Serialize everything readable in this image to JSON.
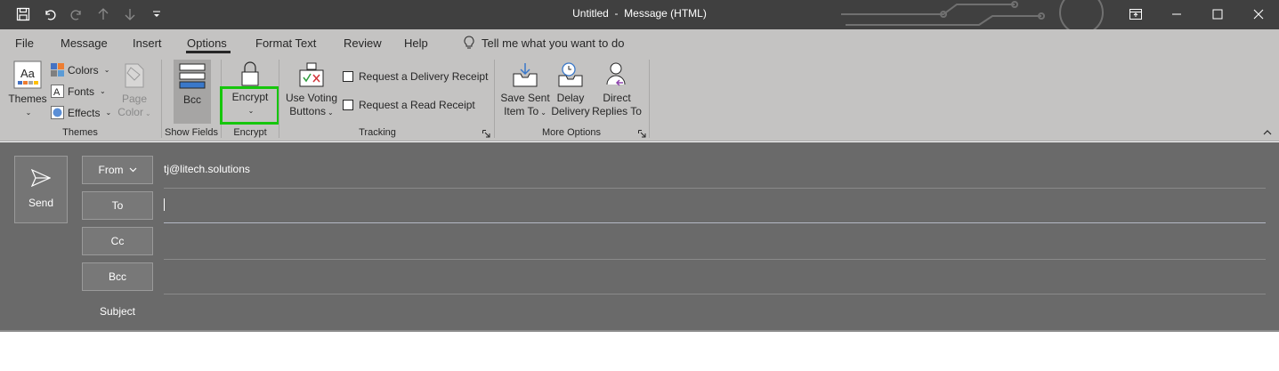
{
  "window": {
    "title": "Untitled  -  Message (HTML)",
    "controls": [
      "ribbon-display-options-icon",
      "minimize-icon",
      "maximize-icon",
      "close-icon"
    ]
  },
  "quick_access": [
    "save-icon",
    "undo-icon",
    "redo-icon",
    "previous-item-icon",
    "next-item-icon",
    "customize-qat-icon"
  ],
  "tabs": [
    {
      "label": "File"
    },
    {
      "label": "Message"
    },
    {
      "label": "Insert"
    },
    {
      "label": "Options"
    },
    {
      "label": "Format Text"
    },
    {
      "label": "Review"
    },
    {
      "label": "Help"
    }
  ],
  "active_tab": "Options",
  "tell_me": {
    "label": "Tell me what you want to do",
    "icon": "lightbulb-icon"
  },
  "ribbon": {
    "themes_group": {
      "label": "Themes",
      "themes_button": "Themes",
      "colors": "Colors",
      "fonts": "Fonts",
      "effects": "Effects",
      "page_color_line1": "Page",
      "page_color_line2": "Color"
    },
    "show_fields_group": {
      "label": "Show Fields",
      "bcc": "Bcc"
    },
    "encrypt_group": {
      "label": "Encrypt",
      "encrypt": "Encrypt"
    },
    "tracking_group": {
      "label": "Tracking",
      "voting_line1": "Use Voting",
      "voting_line2": "Buttons",
      "delivery_receipt": "Request a Delivery Receipt",
      "read_receipt": "Request a Read Receipt"
    },
    "more_options_group": {
      "label": "More Options",
      "save_sent_line1": "Save Sent",
      "save_sent_line2": "Item To",
      "delay_line1": "Delay",
      "delay_line2": "Delivery",
      "direct_line1": "Direct",
      "direct_line2": "Replies To"
    }
  },
  "compose": {
    "send": "Send",
    "from_label": "From",
    "from_value": "tj@litech.solutions",
    "to_label": "To",
    "cc_label": "Cc",
    "bcc_label": "Bcc",
    "subject_label": "Subject"
  },
  "colors": {
    "titlebar": "#404040",
    "ribbon": "#c4c3c2",
    "compose_bg": "#6a6a6a",
    "highlight": "#16c60c"
  }
}
